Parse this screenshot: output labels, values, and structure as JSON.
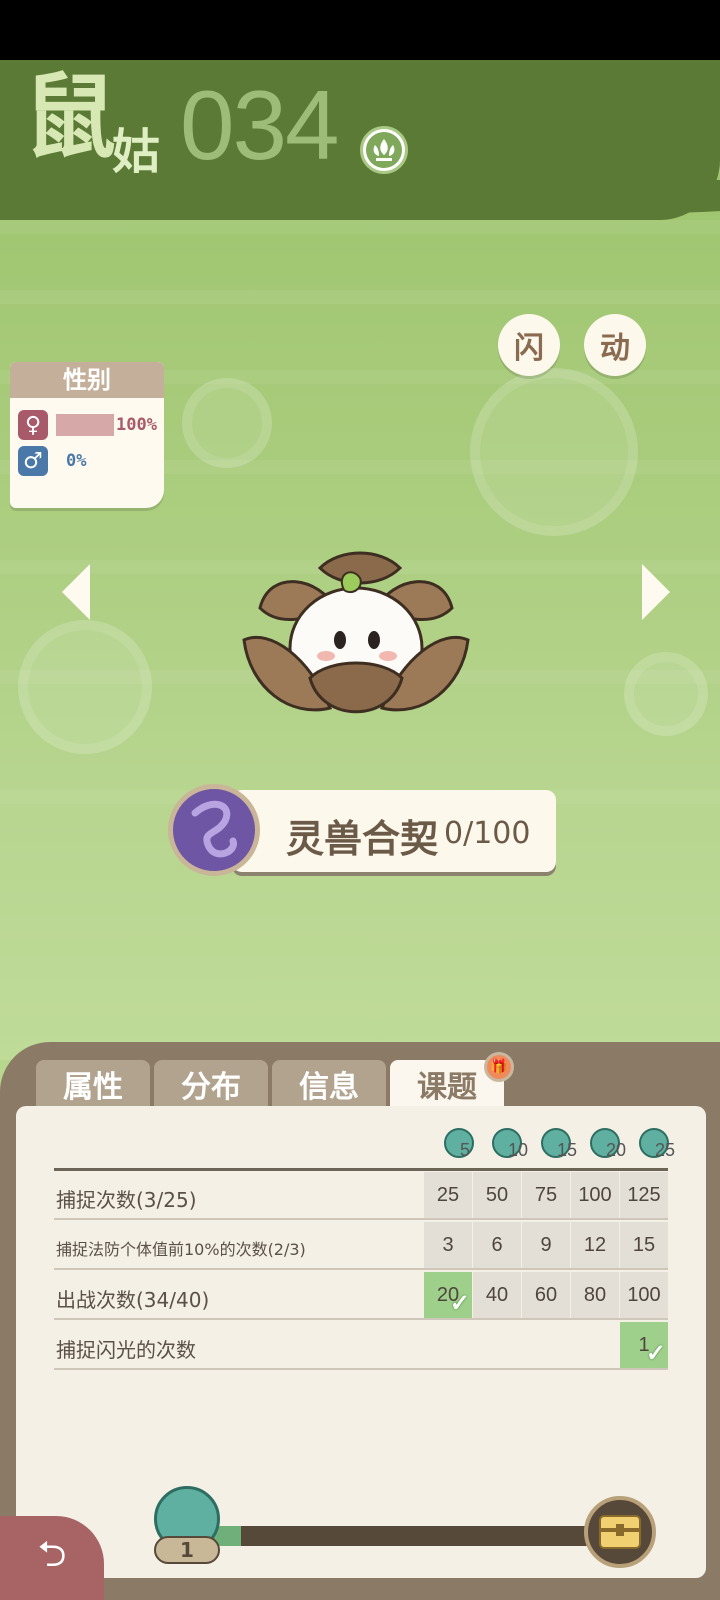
{
  "header": {
    "name_char1": "鼠",
    "name_char2": "姑",
    "number": "034",
    "type_icon": "grass-type-icon"
  },
  "actions": {
    "shiny_label": "闪",
    "animate_label": "动"
  },
  "gender": {
    "title": "性别",
    "female_symbol": "♀",
    "female_percent": "100%",
    "female_ratio": 1.0,
    "male_symbol": "♂",
    "male_percent": "0%",
    "male_ratio": 0.0
  },
  "contract": {
    "label": "灵兽合契",
    "count": "0/100"
  },
  "tabs": [
    {
      "label": "属性",
      "active": false
    },
    {
      "label": "分布",
      "active": false
    },
    {
      "label": "信息",
      "active": false
    },
    {
      "label": "课题",
      "active": true
    }
  ],
  "rewards": [
    "5",
    "10",
    "15",
    "20",
    "25"
  ],
  "tasks": [
    {
      "label": "捕捉次数(3/25)",
      "thresholds": [
        "25",
        "50",
        "75",
        "100",
        "125"
      ],
      "done": [
        false,
        false,
        false,
        false,
        false
      ]
    },
    {
      "label": "捕捉法防个体值前10%的次数(2/3)",
      "thresholds": [
        "3",
        "6",
        "9",
        "12",
        "15"
      ],
      "done": [
        false,
        false,
        false,
        false,
        false
      ]
    },
    {
      "label": "出战次数(34/40)",
      "thresholds": [
        "20",
        "40",
        "60",
        "80",
        "100"
      ],
      "done": [
        true,
        false,
        false,
        false,
        false
      ]
    },
    {
      "label": "捕捉闪光的次数",
      "thresholds": [
        "",
        "",
        "",
        "",
        "1"
      ],
      "done": [
        false,
        false,
        false,
        false,
        true
      ]
    }
  ],
  "progress": {
    "level": "1",
    "fraction": 0.07
  },
  "colors": {
    "header_green": "#5b7a35",
    "panel_brown": "#8b7a66",
    "done_green": "#9ed08c",
    "female_pink": "#a85a6a",
    "male_blue": "#4a78a8"
  }
}
